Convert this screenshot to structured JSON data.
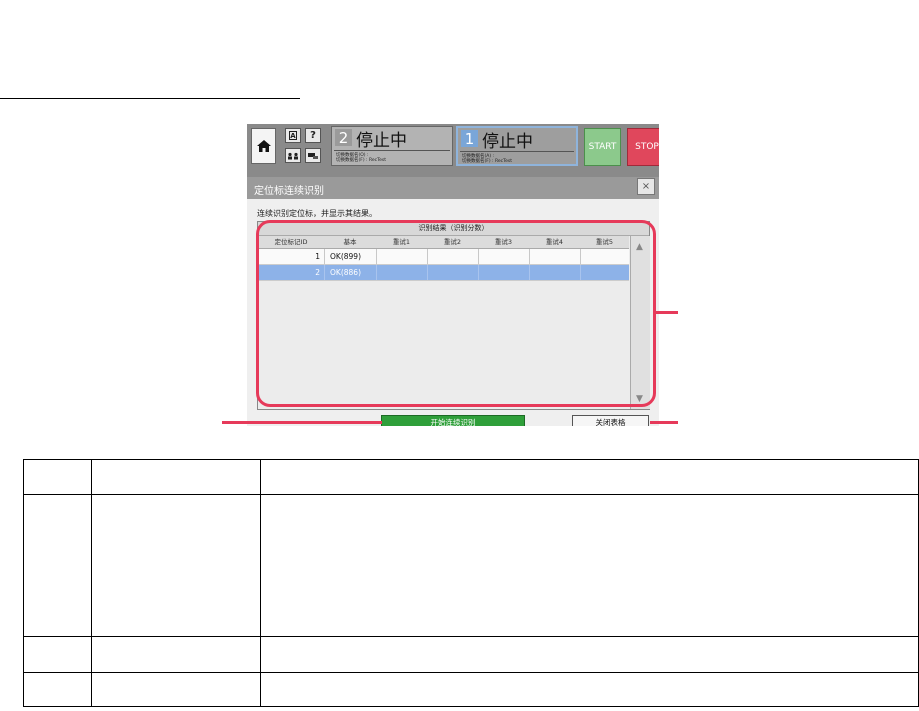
{
  "toolbar": {
    "help_glyph": "?",
    "panel2": {
      "number": "2",
      "status": "停止中",
      "note1": "切换数据名(O) :",
      "note2": "切换数据名(F) : RecTest"
    },
    "panel1": {
      "number": "1",
      "status": "停止中",
      "note1": "切换数据名(A) :",
      "note2": "切换数据名(F) : RecTest"
    },
    "start_label": "START",
    "stop_label": "STOP"
  },
  "dialog": {
    "title": "定位标连续识别",
    "close_glyph": "×",
    "instruction": "连续识别定位标，并显示其结果。",
    "table": {
      "caption": "识别结果（识别分数）",
      "columns": [
        "定位标记ID",
        "基本",
        "重试1",
        "重试2",
        "重试3",
        "重试4",
        "重试5"
      ],
      "rows": [
        {
          "id": "1",
          "basic": "OK(899)",
          "selected": false
        },
        {
          "id": "2",
          "basic": "OK(886)",
          "selected": true
        }
      ]
    },
    "start_continuous_label": "开始连续识别",
    "close_table_label": "关闭表格"
  },
  "colors": {
    "highlight_red": "#e63a5a",
    "start_green": "#2f9f3a",
    "selected_row": "#8db2e8"
  }
}
